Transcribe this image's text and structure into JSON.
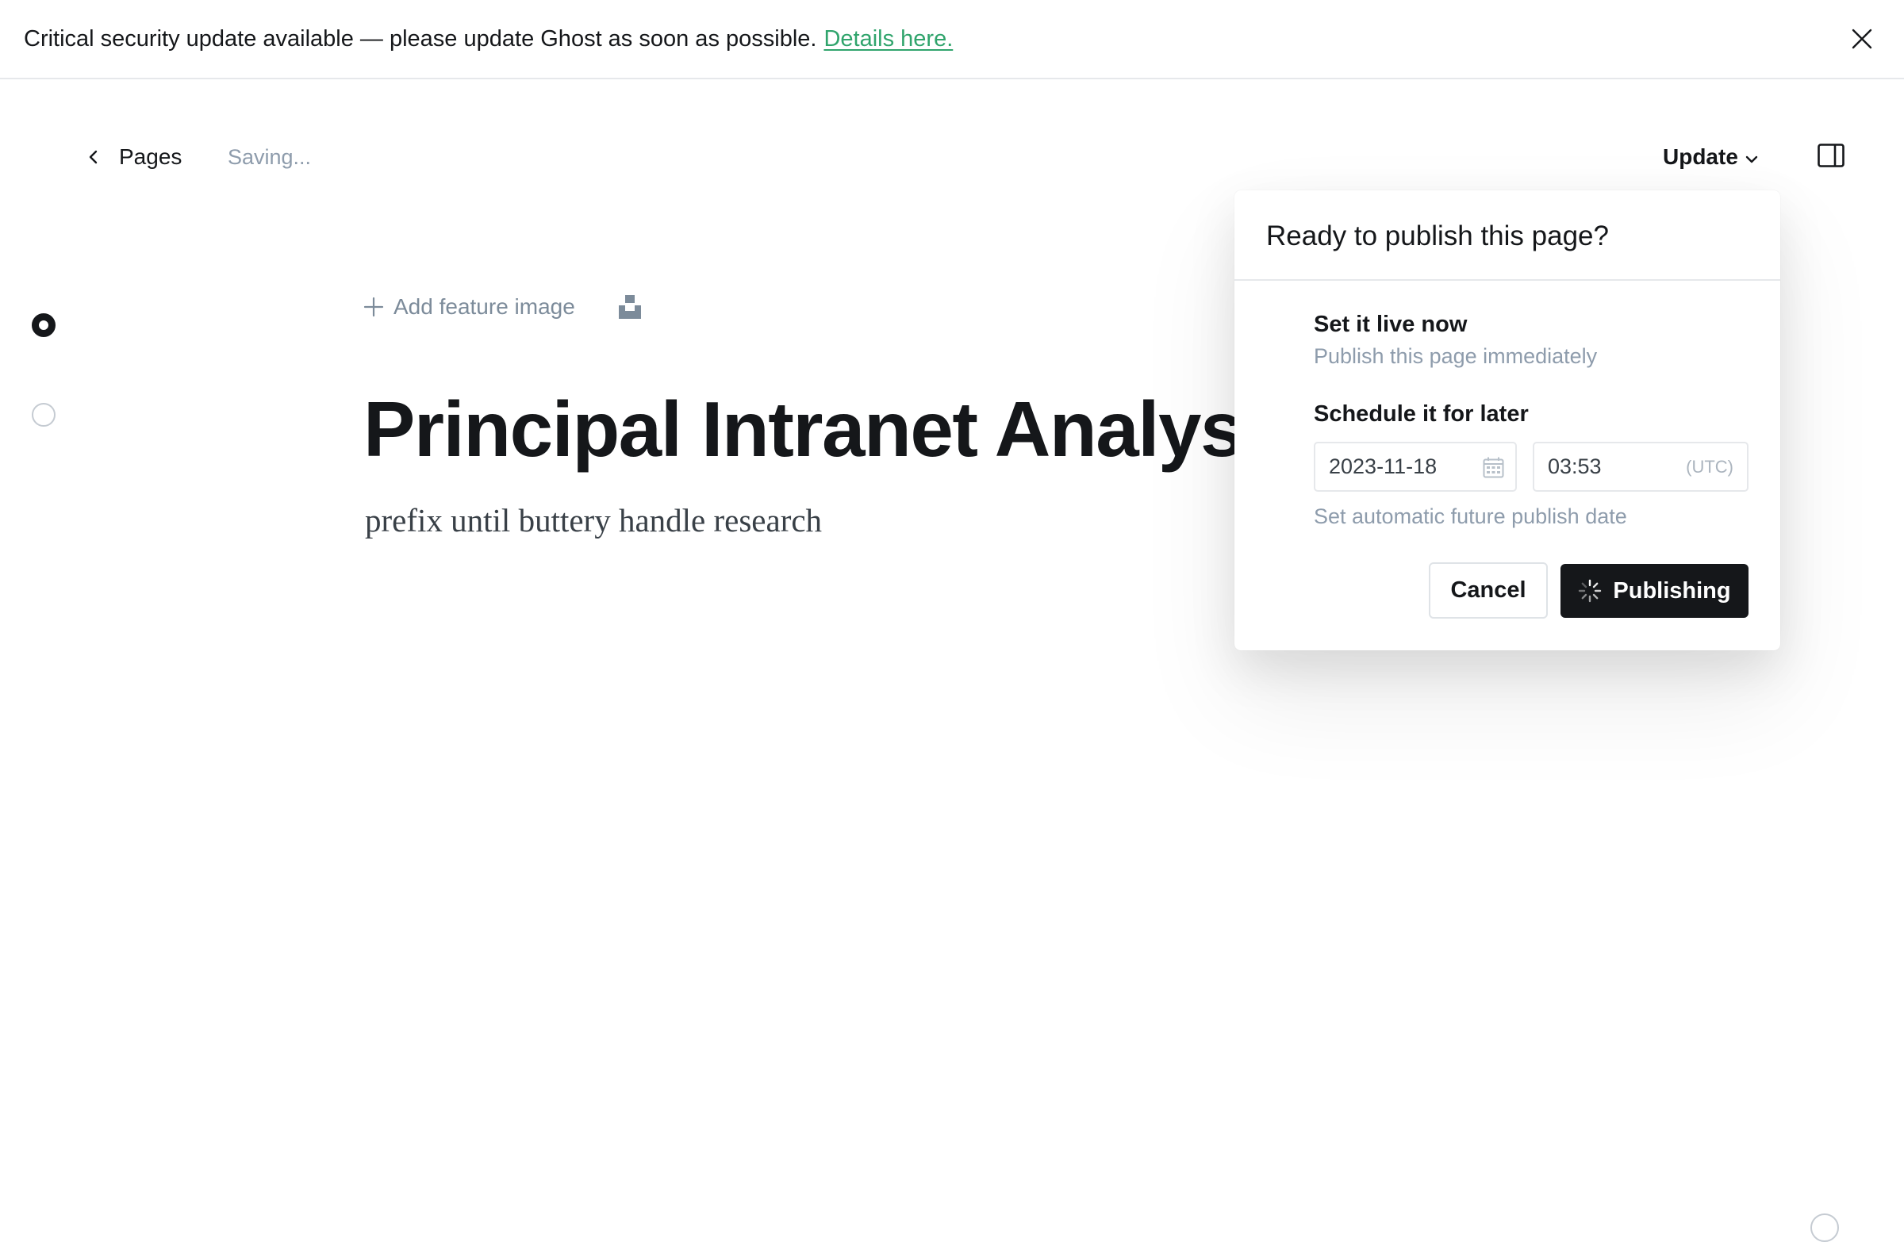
{
  "banner": {
    "message": "Critical security update available — please update Ghost as soon as possible.",
    "link_label": "Details here.",
    "close_icon": "close-icon"
  },
  "header": {
    "back_label": "Pages",
    "save_status": "Saving...",
    "update_label": "Update",
    "sidebar_toggle_icon": "sidebar-toggle-icon"
  },
  "editor": {
    "feature_image_label": "Add feature image",
    "title": "Principal Intranet Analyst",
    "excerpt": "prefix until buttery handle research"
  },
  "publish_popover": {
    "title": "Ready to publish this page?",
    "options": [
      {
        "label": "Set it live now",
        "description": "Publish this page immediately",
        "selected": true
      },
      {
        "label": "Schedule it for later",
        "description": "Set automatic future publish date",
        "selected": false
      }
    ],
    "schedule": {
      "date": "2023-11-18",
      "time": "03:53",
      "timezone": "(UTC)"
    },
    "cancel_label": "Cancel",
    "publish_label": "Publishing"
  },
  "colors": {
    "link_green": "#30a46c",
    "primary_dark": "#15171a",
    "muted_text": "#8e9cac"
  }
}
